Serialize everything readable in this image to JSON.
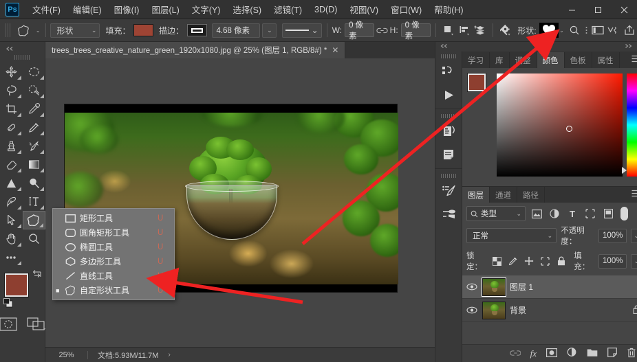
{
  "app": {
    "logo": "Ps",
    "menus": [
      {
        "label": "文件(F)"
      },
      {
        "label": "编辑(E)"
      },
      {
        "label": "图像(I)"
      },
      {
        "label": "图层(L)"
      },
      {
        "label": "文字(Y)"
      },
      {
        "label": "选择(S)"
      },
      {
        "label": "滤镜(T)"
      },
      {
        "label": "3D(D)"
      },
      {
        "label": "视图(V)"
      },
      {
        "label": "窗口(W)"
      },
      {
        "label": "帮助(H)"
      }
    ],
    "window_controls": {
      "minimize": "—",
      "maximize": "▢",
      "close": "✕"
    }
  },
  "options_bar": {
    "tool_icon": "custom-shape-tool-icon",
    "mode_value": "形状",
    "fill_label": "填充：",
    "fill_color": "#9e4434",
    "stroke_label": "描边：",
    "stroke_color": "#1d1d1d",
    "stroke_width": "4.68 像素",
    "width_label": "W:",
    "width_value": "0 像素",
    "link_icon": "link-icon",
    "height_label": "H:",
    "height_value": "0 像素",
    "path_ops_icon": "path-operations-icon",
    "path_align_icon": "path-alignment-icon",
    "path_arrange_icon": "path-arrangement-icon",
    "gear_icon": "gear-icon",
    "shape_label": "形状:",
    "shape_preview": "heart-shape-icon",
    "search_icon": "search-icon",
    "workspace_icon": "workspace-icon",
    "more_icon": "more-options-icon",
    "share_icon": "share-icon"
  },
  "toolbar": {
    "collapse_icon": "collapse-left-icon",
    "tools": [
      {
        "name": "move-tool",
        "glyph": "✥",
        "has_submenu": true
      },
      {
        "name": "marquee-tool",
        "glyph": "◌",
        "has_submenu": true
      },
      {
        "name": "lasso-tool",
        "glyph": "◯",
        "has_submenu": true
      },
      {
        "name": "quick-selection-tool",
        "glyph": "✧",
        "has_submenu": true
      },
      {
        "name": "crop-tool",
        "glyph": "⌗",
        "has_submenu": true
      },
      {
        "name": "eyedropper-tool",
        "glyph": "✎",
        "has_submenu": true
      },
      {
        "name": "spot-healing-tool",
        "glyph": "✚",
        "has_submenu": true
      },
      {
        "name": "brush-tool",
        "glyph": "✏",
        "has_submenu": true
      },
      {
        "name": "clone-stamp-tool",
        "glyph": "▮",
        "has_submenu": true
      },
      {
        "name": "history-brush-tool",
        "glyph": "↯",
        "has_submenu": true
      },
      {
        "name": "eraser-tool",
        "glyph": "▱",
        "has_submenu": true
      },
      {
        "name": "gradient-tool",
        "glyph": "▤",
        "has_submenu": true
      },
      {
        "name": "blur-tool",
        "glyph": "▲",
        "has_submenu": true
      },
      {
        "name": "dodge-tool",
        "glyph": "◍",
        "has_submenu": true
      },
      {
        "name": "pen-tool",
        "glyph": "✒",
        "has_submenu": true
      },
      {
        "name": "type-tool",
        "glyph": "T",
        "has_submenu": true
      },
      {
        "name": "path-selection-tool",
        "glyph": "➤",
        "has_submenu": true
      },
      {
        "name": "custom-shape-tool",
        "glyph": "★",
        "has_submenu": true,
        "active": true
      },
      {
        "name": "hand-tool",
        "glyph": "✋",
        "has_submenu": true
      },
      {
        "name": "zoom-tool",
        "glyph": "⌕",
        "has_submenu": false
      },
      {
        "name": "edit-toolbar",
        "glyph": "•••",
        "has_submenu": true
      }
    ],
    "foreground_color": "#8e3f30",
    "background_color": "#e8cf1a",
    "swap_icon": "swap-colors-icon",
    "default_colors_icon": "default-colors-icon",
    "quickmask_icon": "quick-mask-icon",
    "screenmode_icon": "screen-mode-icon"
  },
  "document": {
    "tab_title": "trees_trees_creative_nature_green_1920x1080.jpg @ 25% (图层 1, RGB/8#) *",
    "close_icon": "✕"
  },
  "status_bar": {
    "zoom": "25%",
    "doc_info": "文档:5.93M/11.7M",
    "expand_icon": "›"
  },
  "shape_flyout": {
    "items": [
      {
        "label": "矩形工具",
        "key": "U",
        "icon": "rectangle-icon",
        "selected": false
      },
      {
        "label": "圆角矩形工具",
        "key": "U",
        "icon": "rounded-rectangle-icon",
        "selected": false
      },
      {
        "label": "椭圆工具",
        "key": "U",
        "icon": "ellipse-icon",
        "selected": false
      },
      {
        "label": "多边形工具",
        "key": "U",
        "icon": "polygon-icon",
        "selected": false
      },
      {
        "label": "直线工具",
        "key": "U",
        "icon": "line-icon",
        "selected": false
      },
      {
        "label": "自定形状工具",
        "key": "U",
        "icon": "custom-shape-icon",
        "selected": true
      }
    ]
  },
  "right_dock": {
    "collapse_left_icon": "«",
    "collapse_right_icon": "»",
    "mini_icons": [
      {
        "name": "history-panel-icon",
        "glyph": "↺"
      },
      {
        "name": "actions-panel-icon",
        "glyph": "▶"
      },
      {
        "name": "adjustments-panel-icon",
        "glyph": "▤"
      },
      {
        "name": "notes-panel-icon",
        "glyph": "▥"
      },
      {
        "name": "brush-settings-icon",
        "glyph": "✎"
      },
      {
        "name": "brushes-panel-icon",
        "glyph": "⌁"
      }
    ],
    "color_panel": {
      "tabs": [
        {
          "label": "学习",
          "active": false
        },
        {
          "label": "库",
          "active": false
        },
        {
          "label": "调整",
          "active": false
        },
        {
          "label": "颜色",
          "active": true
        },
        {
          "label": "色板",
          "active": false
        },
        {
          "label": "属性",
          "active": false
        }
      ],
      "menu_icon": "panel-menu-icon",
      "foreground_color": "#8e3f30",
      "background_color": "#e8cf1a"
    },
    "layers_panel": {
      "tabs": [
        {
          "label": "图层",
          "active": true
        },
        {
          "label": "通道",
          "active": false
        },
        {
          "label": "路径",
          "active": false
        }
      ],
      "menu_icon": "panel-menu-icon",
      "filter_label": "类型",
      "filter_icons": [
        {
          "name": "filter-pixel-icon",
          "glyph": "▣"
        },
        {
          "name": "filter-adjustment-icon",
          "glyph": "◐"
        },
        {
          "name": "filter-type-icon",
          "glyph": "T"
        },
        {
          "name": "filter-shape-icon",
          "glyph": "⌗"
        },
        {
          "name": "filter-smart-object-icon",
          "glyph": "▤"
        }
      ],
      "blend_mode": "正常",
      "opacity_label": "不透明度：",
      "opacity_value": "100%",
      "lock_label": "锁定：",
      "lock_icons": [
        {
          "name": "lock-transparency-icon",
          "glyph": "▨"
        },
        {
          "name": "lock-image-icon",
          "glyph": "✎"
        },
        {
          "name": "lock-position-icon",
          "glyph": "✥"
        },
        {
          "name": "lock-nesting-icon",
          "glyph": "⌗"
        },
        {
          "name": "lock-all-icon",
          "glyph": "🔒"
        }
      ],
      "fill_label": "填充：",
      "fill_value": "100%",
      "layers": [
        {
          "name": "图层 1",
          "visible": true,
          "selected": true,
          "locked": false
        },
        {
          "name": "背景",
          "visible": true,
          "selected": false,
          "locked": true
        }
      ],
      "bottom_icons": [
        {
          "name": "link-layers-icon",
          "glyph": "⛓"
        },
        {
          "name": "layer-style-icon",
          "glyph": "fx"
        },
        {
          "name": "layer-mask-icon",
          "glyph": "◉"
        },
        {
          "name": "adjustment-layer-icon",
          "glyph": "◑"
        },
        {
          "name": "new-group-icon",
          "glyph": "▭"
        },
        {
          "name": "new-layer-icon",
          "glyph": "❐"
        },
        {
          "name": "delete-layer-icon",
          "glyph": "🗑"
        }
      ]
    }
  },
  "annotations": {
    "arrow_color": "#ee2222",
    "arrows": [
      {
        "name": "arrow-to-shape-preview"
      },
      {
        "name": "arrow-to-custom-shape-tool"
      }
    ]
  }
}
